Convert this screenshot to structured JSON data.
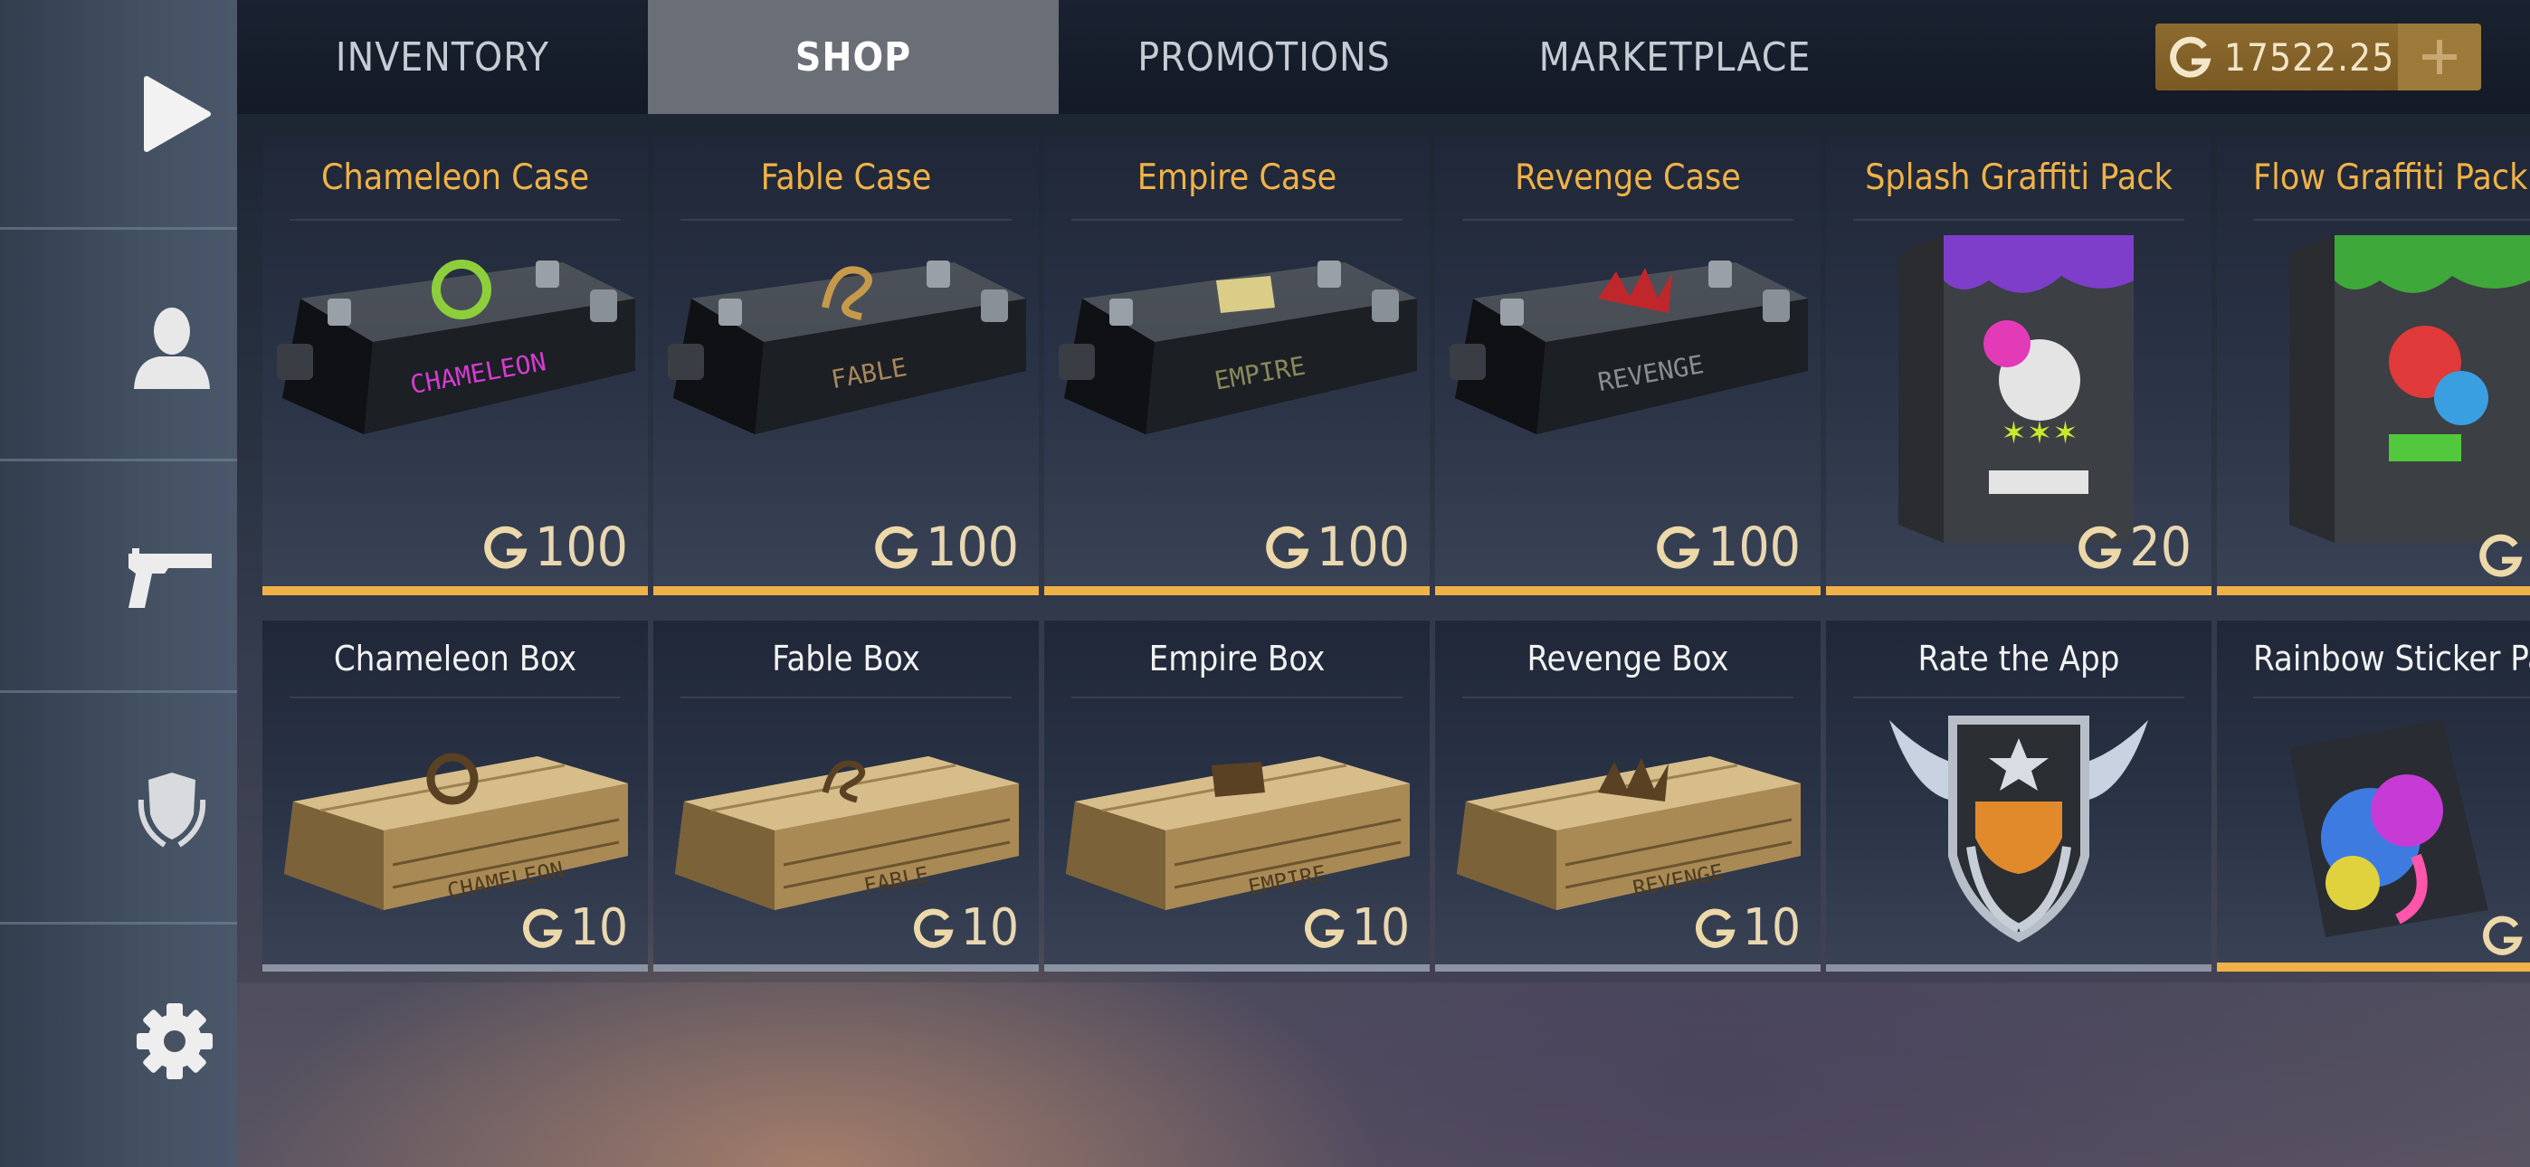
{
  "sidebar": {
    "items": [
      {
        "name": "play",
        "icon": "play-icon"
      },
      {
        "name": "profile",
        "icon": "person-icon"
      },
      {
        "name": "weapons",
        "icon": "pistol-icon"
      },
      {
        "name": "rank",
        "icon": "shield-laurel-icon"
      },
      {
        "name": "settings",
        "icon": "gear-icon"
      }
    ]
  },
  "tabs": [
    {
      "label": "INVENTORY",
      "active": false
    },
    {
      "label": "SHOP",
      "active": true
    },
    {
      "label": "PROMOTIONS",
      "active": false
    },
    {
      "label": "MARKETPLACE",
      "active": false
    }
  ],
  "currency": {
    "icon": "gold-g-icon",
    "amount": "17522.25",
    "add_icon": "plus-icon"
  },
  "colors": {
    "accent": "#f0b247",
    "active_tab": "#6a6f77",
    "gold": "#8d6a2e"
  },
  "shop": {
    "row1": [
      {
        "title": "Chameleon Case",
        "price": "100",
        "art": "weapon-case-chameleon"
      },
      {
        "title": "Fable Case",
        "price": "100",
        "art": "weapon-case-fable"
      },
      {
        "title": "Empire Case",
        "price": "100",
        "art": "weapon-case-empire"
      },
      {
        "title": "Revenge Case",
        "price": "100",
        "art": "weapon-case-revenge"
      },
      {
        "title": "Splash Graffiti Pack",
        "price": "20",
        "art": "graffiti-pack-splash"
      },
      {
        "title": "Flow Graffiti Pack",
        "price": "",
        "art": "graffiti-pack-flow"
      }
    ],
    "row2": [
      {
        "title": "Chameleon Box",
        "price": "10",
        "art": "wooden-box-chameleon"
      },
      {
        "title": "Fable Box",
        "price": "10",
        "art": "wooden-box-fable"
      },
      {
        "title": "Empire Box",
        "price": "10",
        "art": "wooden-box-empire"
      },
      {
        "title": "Revenge Box",
        "price": "10",
        "art": "wooden-box-revenge"
      },
      {
        "title": "Rate the App",
        "price": "",
        "art": "emblem-badge"
      },
      {
        "title": "Rainbow Sticker Pa",
        "price": "",
        "art": "sticker-pack-rainbow"
      }
    ],
    "case_labels": {
      "chameleon": "CHAMELEON",
      "fable": "FABLE",
      "empire": "EMPIRE",
      "revenge": "REVENGE"
    }
  }
}
